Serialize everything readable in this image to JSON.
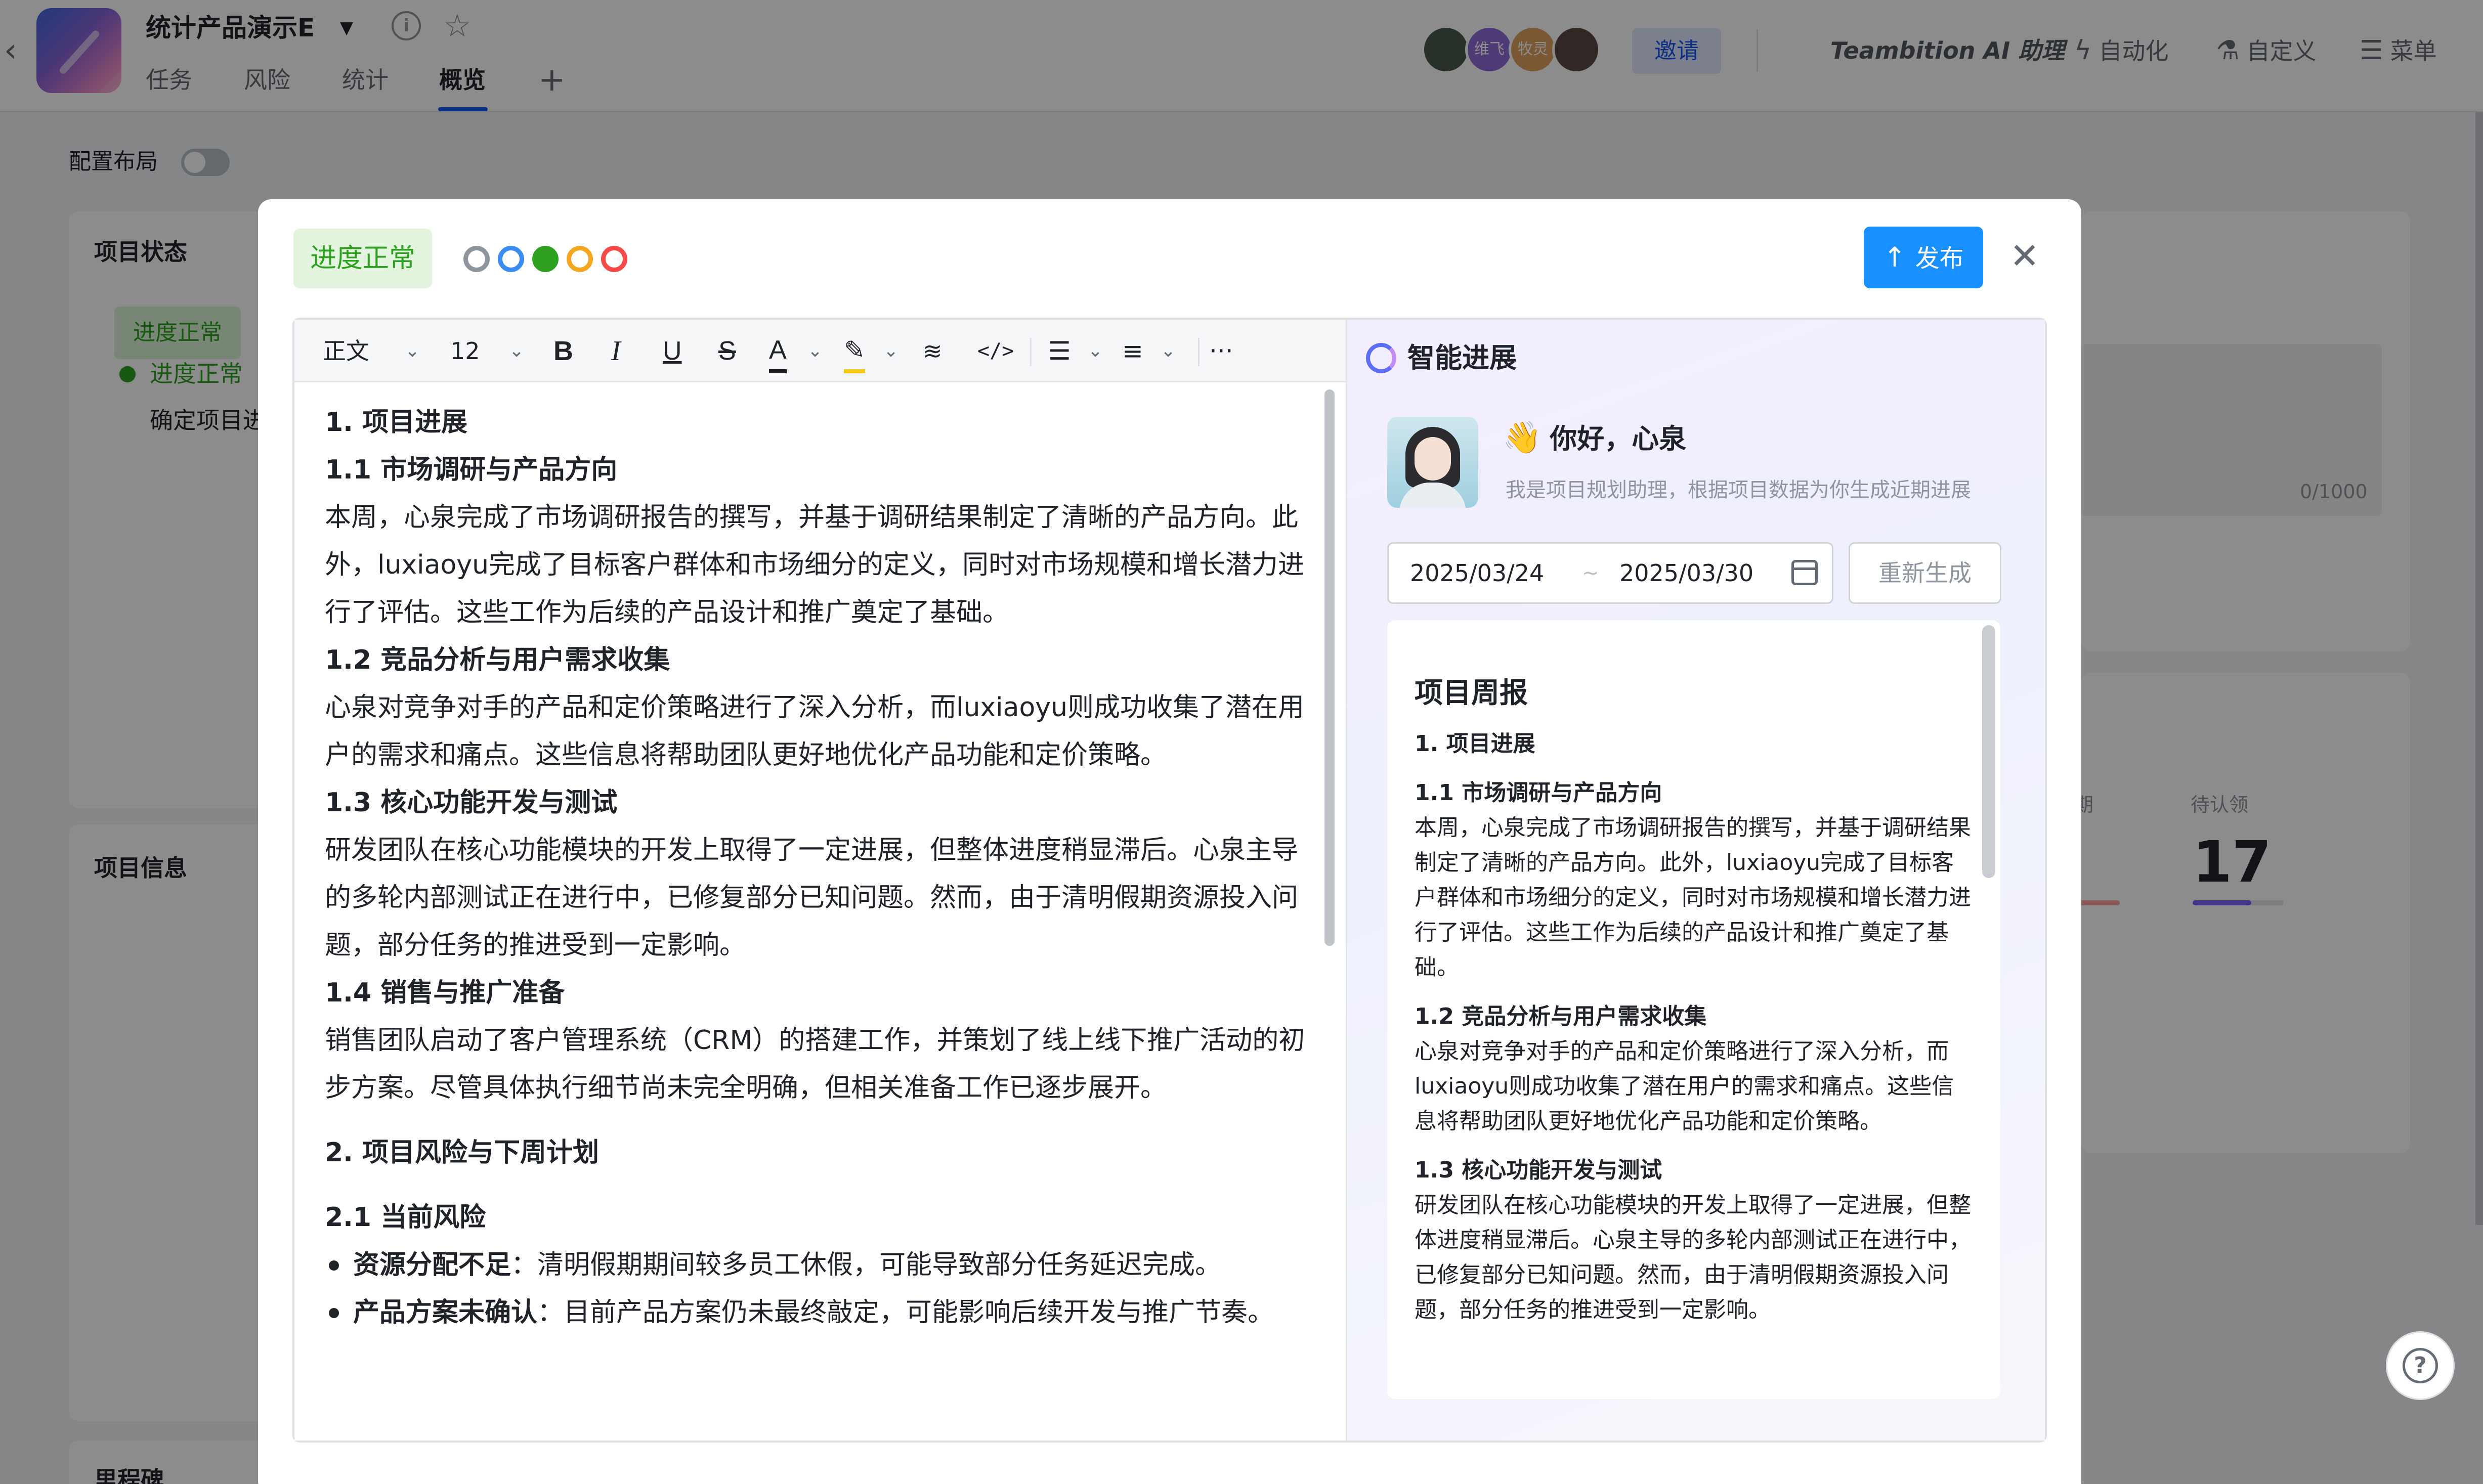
{
  "header": {
    "project_title": "统计产品演示E",
    "tabs": [
      {
        "label": "任务"
      },
      {
        "label": "风险"
      },
      {
        "label": "统计"
      },
      {
        "label": "概览"
      }
    ],
    "avatars": [
      {
        "label": "",
        "color": "#4a5a4c"
      },
      {
        "label": "维飞",
        "color": "#8e6bd6"
      },
      {
        "label": "牧灵",
        "color": "#e0a060"
      },
      {
        "label": "",
        "color": "#5a4a44"
      }
    ],
    "invite_label": "邀请",
    "ai_assistant_label": "Teambition AI 助理",
    "automation_label": "自动化",
    "customize_label": "自定义",
    "menu_label": "菜单"
  },
  "page": {
    "config_layout_label": "配置布局",
    "project_status_title": "项目状态",
    "status_tag": "进度正常",
    "status_item": "进度正常",
    "status_desc_partial": "确定项目进",
    "project_info_title": "项目信息",
    "milestone_title": "里程碑",
    "char_counter": "0/1000",
    "stat_label_partial": "期",
    "pending_claim_label": "待认领",
    "pending_claim_value": "17"
  },
  "modal": {
    "status_tag": "进度正常",
    "status_dots": [
      {
        "name": "gray",
        "color": "#8f959e"
      },
      {
        "name": "blue",
        "color": "#3b8ef0"
      },
      {
        "name": "green",
        "color": "#2ea121",
        "selected": true
      },
      {
        "name": "orange",
        "color": "#f5a623"
      },
      {
        "name": "red",
        "color": "#f54a45"
      }
    ],
    "publish_label": "发布",
    "toolbar": {
      "style_select": "正文",
      "font_size_select": "12"
    },
    "editor": {
      "blocks": [
        {
          "type": "h",
          "text": "1. 项目进展"
        },
        {
          "type": "h",
          "text": "1.1 市场调研与产品方向"
        },
        {
          "type": "p",
          "text": "本周，心泉完成了市场调研报告的撰写，并基于调研结果制定了清晰的产品方向。此外，luxiaoyu完成了目标客户群体和市场细分的定义，同时对市场规模和增长潜力进行了评估。这些工作为后续的产品设计和推广奠定了基础。"
        },
        {
          "type": "h",
          "text": "1.2 竞品分析与用户需求收集"
        },
        {
          "type": "p",
          "text": "心泉对竞争对手的产品和定价策略进行了深入分析，而luxiaoyu则成功收集了潜在用户的需求和痛点。这些信息将帮助团队更好地优化产品功能和定价策略。"
        },
        {
          "type": "h",
          "text": "1.3 核心功能开发与测试"
        },
        {
          "type": "p",
          "text": "研发团队在核心功能模块的开发上取得了一定进展，但整体进度稍显滞后。心泉主导的多轮内部测试正在进行中，已修复部分已知问题。然而，由于清明假期资源投入问题，部分任务的推进受到一定影响。"
        },
        {
          "type": "h",
          "text": "1.4 销售与推广准备"
        },
        {
          "type": "p",
          "text": "销售团队启动了客户管理系统（CRM）的搭建工作，并策划了线上线下推广活动的初步方案。尽管具体执行细节尚未完全明确，但相关准备工作已逐步展开。"
        },
        {
          "type": "gap"
        },
        {
          "type": "h",
          "text": "2. 项目风险与下周计划"
        },
        {
          "type": "gap"
        },
        {
          "type": "h",
          "text": "2.1 当前风险"
        },
        {
          "type": "li",
          "bold": "资源分配不足",
          "text": "：清明假期期间较多员工休假，可能导致部分任务延迟完成。"
        },
        {
          "type": "li",
          "bold": "产品方案未确认",
          "text": "：目前产品方案仍未最终敲定，可能影响后续开发与推广节奏。"
        }
      ]
    },
    "ai_panel": {
      "title": "智能进展",
      "greeting": "你好，心泉",
      "subtitle": "我是项目规划助理，根据项目数据为你生成近期进展",
      "date_start": "2025/03/24",
      "date_sep": "~",
      "date_end": "2025/03/30",
      "regenerate_label": "重新生成",
      "report": {
        "title": "项目周报",
        "sections": [
          {
            "type": "h",
            "text": "1. 项目进展"
          },
          {
            "type": "h",
            "text": "1.1 市场调研与产品方向"
          },
          {
            "type": "p",
            "text": "本周，心泉完成了市场调研报告的撰写，并基于调研结果制定了清晰的产品方向。此外，luxiaoyu完成了目标客户群体和市场细分的定义，同时对市场规模和增长潜力进行了评估。这些工作为后续的产品设计和推广奠定了基础。"
          },
          {
            "type": "h",
            "text": "1.2 竞品分析与用户需求收集"
          },
          {
            "type": "p",
            "text": "心泉对竞争对手的产品和定价策略进行了深入分析，而luxiaoyu则成功收集了潜在用户的需求和痛点。这些信息将帮助团队更好地优化产品功能和定价策略。"
          },
          {
            "type": "h",
            "text": "1.3 核心功能开发与测试"
          },
          {
            "type": "p",
            "text": "研发团队在核心功能模块的开发上取得了一定进展，但整体进度稍显滞后。心泉主导的多轮内部测试正在进行中，已修复部分已知问题。然而，由于清明假期资源投入问题，部分任务的推进受到一定影响。"
          }
        ]
      }
    }
  }
}
